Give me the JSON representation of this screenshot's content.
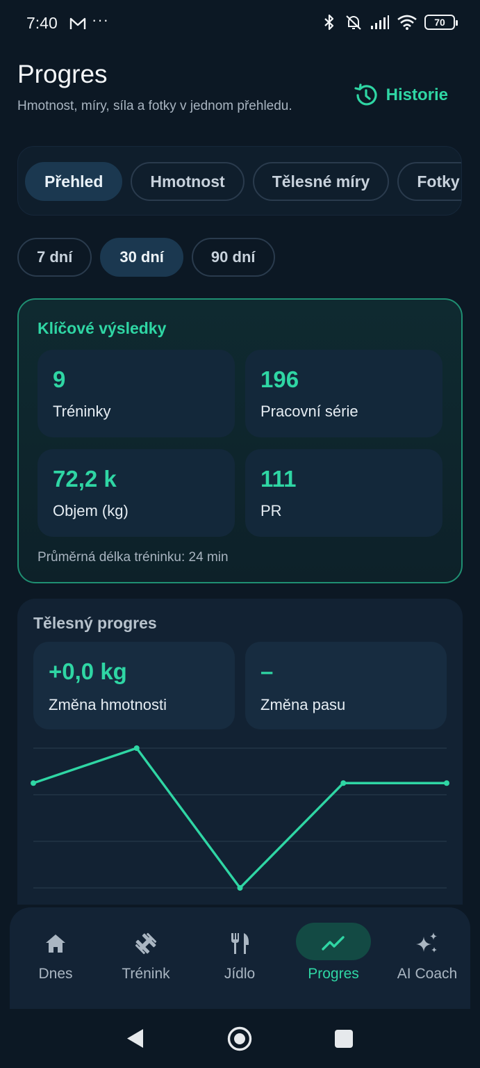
{
  "status_bar": {
    "time": "7:40",
    "dots": "···",
    "battery": "70"
  },
  "header": {
    "title": "Progres",
    "subtitle": "Hmotnost, míry, síla a fotky v jednom přehledu.",
    "history_label": "Historie"
  },
  "tabs": [
    {
      "label": "Přehled",
      "active": true
    },
    {
      "label": "Hmotnost",
      "active": false
    },
    {
      "label": "Tělesné míry",
      "active": false
    },
    {
      "label": "Fotky",
      "active": false
    }
  ],
  "ranges": [
    {
      "label": "7 dní",
      "active": false
    },
    {
      "label": "30 dní",
      "active": true
    },
    {
      "label": "90 dní",
      "active": false
    }
  ],
  "key_results": {
    "title": "Klíčové výsledky",
    "stats": [
      {
        "value": "9",
        "label": "Tréninky"
      },
      {
        "value": "196",
        "label": "Pracovní série"
      },
      {
        "value": "72,2 k",
        "label": "Objem (kg)"
      },
      {
        "value": "111",
        "label": "PR"
      }
    ],
    "footer": "Průměrná délka tréninku: 24 min"
  },
  "body_progress": {
    "title": "Tělesný progres",
    "stats": [
      {
        "value": "+0,0 kg",
        "label": "Změna hmotnosti"
      },
      {
        "value": "–",
        "label": "Změna pasu"
      }
    ]
  },
  "chart_data": {
    "type": "line",
    "series": [
      {
        "values": [
          2.25,
          3.0,
          0.0,
          2.25,
          2.25
        ]
      }
    ],
    "ylim": [
      0,
      3
    ],
    "grid": true,
    "line_color": "#2fd6a4"
  },
  "bottom_nav": [
    {
      "label": "Dnes",
      "icon": "home-icon",
      "active": false
    },
    {
      "label": "Trénink",
      "icon": "dumbbell-icon",
      "active": false
    },
    {
      "label": "Jídlo",
      "icon": "fork-knife-icon",
      "active": false
    },
    {
      "label": "Progres",
      "icon": "trend-icon",
      "active": true
    },
    {
      "label": "AI Coach",
      "icon": "sparkles-icon",
      "active": false
    }
  ],
  "colors": {
    "accent": "#2fd6a4",
    "background": "#0c1824"
  }
}
